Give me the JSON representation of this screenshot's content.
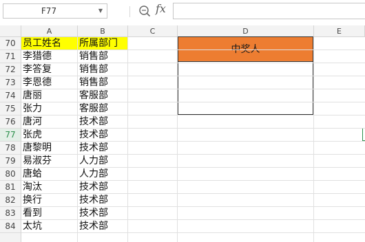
{
  "formula_bar": {
    "name_box": "F77",
    "name_box_arrow_icon": "chevron-down-icon",
    "zoom_icon": "magnify-icon",
    "fx_label": "fx",
    "formula_value": ""
  },
  "columns": [
    "A",
    "B",
    "C",
    "D",
    "E"
  ],
  "row_numbers": [
    "70",
    "71",
    "72",
    "73",
    "74",
    "75",
    "76",
    "77",
    "78",
    "79",
    "80",
    "81",
    "82",
    "83",
    "84"
  ],
  "active_row": "77",
  "rows": [
    {
      "a": "员工姓名",
      "b": "所属部门"
    },
    {
      "a": "李猎德",
      "b": "销售部"
    },
    {
      "a": "李答复",
      "b": "销售部"
    },
    {
      "a": "李恩德",
      "b": "销售部"
    },
    {
      "a": "唐丽",
      "b": "客服部"
    },
    {
      "a": "张力",
      "b": "客服部"
    },
    {
      "a": "唐河",
      "b": "技术部"
    },
    {
      "a": "张虎",
      "b": "技术部"
    },
    {
      "a": "唐黎明",
      "b": "技术部"
    },
    {
      "a": "易淑芬",
      "b": "人力部"
    },
    {
      "a": "唐蛤",
      "b": "人力部"
    },
    {
      "a": "淘汰",
      "b": "技术部"
    },
    {
      "a": "换行",
      "b": "技术部"
    },
    {
      "a": "看到",
      "b": "技术部"
    },
    {
      "a": "太坑",
      "b": "技术部"
    }
  ],
  "winner_box": {
    "title": "中奖人",
    "value": "",
    "header_color": "#ed7d31"
  },
  "colors": {
    "header_highlight": "#ffff00",
    "active_accent": "#2a8f4a"
  }
}
